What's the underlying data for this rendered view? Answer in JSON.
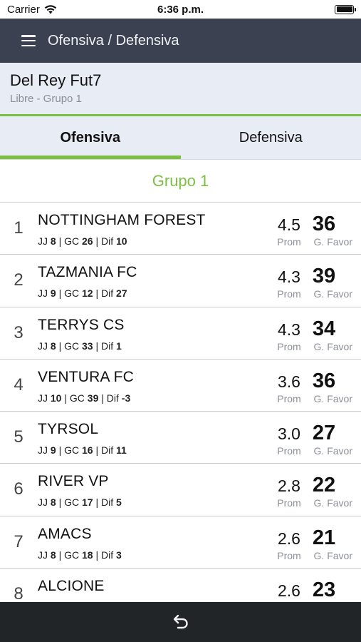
{
  "status": {
    "carrier": "Carrier",
    "time": "6:36 p.m."
  },
  "navbar": {
    "title": "Ofensiva / Defensiva"
  },
  "league": {
    "name": "Del Rey Fut7",
    "subtitle": "Libre - Grupo 1"
  },
  "tabs": [
    {
      "label": "Ofensiva",
      "active": true
    },
    {
      "label": "Defensiva",
      "active": false
    }
  ],
  "group": {
    "title": "Grupo 1"
  },
  "labels": {
    "jj": "JJ",
    "gc": "GC",
    "dif": "Dif",
    "prom": "Prom",
    "gfavor": "G. Favor"
  },
  "rows": [
    {
      "rank": "1",
      "team": "NOTTINGHAM FOREST",
      "jj": "8",
      "gc": "26",
      "dif": "10",
      "prom": "4.5",
      "gf": "36"
    },
    {
      "rank": "2",
      "team": "TAZMANIA FC",
      "jj": "9",
      "gc": "12",
      "dif": "27",
      "prom": "4.3",
      "gf": "39"
    },
    {
      "rank": "3",
      "team": "TERRYS CS",
      "jj": "8",
      "gc": "33",
      "dif": "1",
      "prom": "4.3",
      "gf": "34"
    },
    {
      "rank": "4",
      "team": "VENTURA FC",
      "jj": "10",
      "gc": "39",
      "dif": "-3",
      "prom": "3.6",
      "gf": "36"
    },
    {
      "rank": "5",
      "team": "TYRSOL",
      "jj": "9",
      "gc": "16",
      "dif": "11",
      "prom": "3.0",
      "gf": "27"
    },
    {
      "rank": "6",
      "team": "RIVER VP",
      "jj": "8",
      "gc": "17",
      "dif": "5",
      "prom": "2.8",
      "gf": "22"
    },
    {
      "rank": "7",
      "team": "AMACS",
      "jj": "8",
      "gc": "18",
      "dif": "3",
      "prom": "2.6",
      "gf": "21"
    },
    {
      "rank": "8",
      "team": "ALCIONE",
      "jj": "",
      "gc": "",
      "dif": "",
      "prom": "2.6",
      "gf": "23"
    }
  ],
  "icons": {
    "menu": "hamburger-icon",
    "back": "back-arrow-icon",
    "wifi": "wifi-icon",
    "battery": "battery-icon"
  },
  "colors": {
    "accent": "#7bc043",
    "navbar": "#3b4150",
    "header_bg": "#e8edf5",
    "bottom_bar": "#222528"
  }
}
